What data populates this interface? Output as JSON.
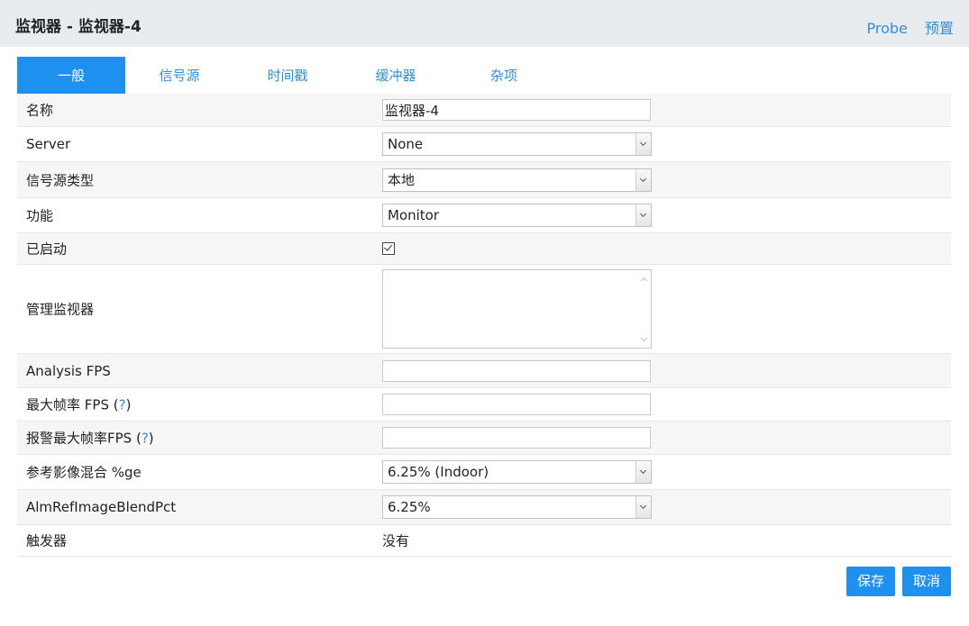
{
  "header": {
    "title": "监视器 - 监视器-4",
    "link_probe": "Probe",
    "link_presets": "预置"
  },
  "tabs": [
    {
      "label": "一般",
      "active": true
    },
    {
      "label": "信号源",
      "active": false
    },
    {
      "label": "时间戳",
      "active": false
    },
    {
      "label": "缓冲器",
      "active": false
    },
    {
      "label": "杂项",
      "active": false
    }
  ],
  "form": {
    "name": {
      "label": "名称",
      "value": "监视器-4"
    },
    "server": {
      "label": "Server",
      "value": "None"
    },
    "source_type": {
      "label": "信号源类型",
      "value": "本地"
    },
    "function": {
      "label": "功能",
      "value": "Monitor"
    },
    "enabled": {
      "label": "已启动",
      "checked": true
    },
    "linked_monitors": {
      "label": "管理监视器"
    },
    "analysis_fps": {
      "label": "Analysis FPS",
      "value": ""
    },
    "max_fps": {
      "label_prefix": "最大帧率 FPS (",
      "help": "?",
      "label_suffix": ")",
      "value": ""
    },
    "alarm_max_fps": {
      "label_prefix": "报警最大帧率FPS (",
      "help": "?",
      "label_suffix": ")",
      "value": ""
    },
    "ref_blend": {
      "label": "参考影像混合 %ge",
      "value": "6.25% (Indoor)"
    },
    "alarm_ref_blend": {
      "label": "AlmRefImageBlendPct",
      "value": "6.25%"
    },
    "triggers": {
      "label": "触发器",
      "value": "没有"
    }
  },
  "buttons": {
    "save": "保存",
    "cancel": "取消"
  },
  "colors": {
    "accent": "#1e90f0",
    "link": "#2f8fd8",
    "header_bg": "#e9ecef",
    "row_alt_bg": "#f6f6f6"
  }
}
